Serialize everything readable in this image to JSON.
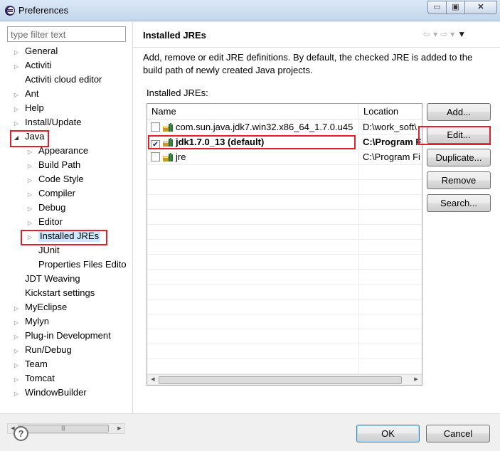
{
  "window": {
    "title": "Preferences",
    "minimize_glyph": "▭",
    "maximize_glyph": "▣",
    "close_glyph": "✕"
  },
  "filter": {
    "placeholder": "type filter text"
  },
  "tree": {
    "items": [
      {
        "label": "General",
        "depth": 0,
        "toggle": "collapsed"
      },
      {
        "label": "Activiti",
        "depth": 0,
        "toggle": "collapsed"
      },
      {
        "label": "Activiti cloud editor",
        "depth": 0,
        "toggle": "none"
      },
      {
        "label": "Ant",
        "depth": 0,
        "toggle": "collapsed"
      },
      {
        "label": "Help",
        "depth": 0,
        "toggle": "collapsed"
      },
      {
        "label": "Install/Update",
        "depth": 0,
        "toggle": "collapsed"
      },
      {
        "label": "Java",
        "depth": 0,
        "toggle": "expanded"
      },
      {
        "label": "Appearance",
        "depth": 1,
        "toggle": "collapsed"
      },
      {
        "label": "Build Path",
        "depth": 1,
        "toggle": "collapsed"
      },
      {
        "label": "Code Style",
        "depth": 1,
        "toggle": "collapsed"
      },
      {
        "label": "Compiler",
        "depth": 1,
        "toggle": "collapsed"
      },
      {
        "label": "Debug",
        "depth": 1,
        "toggle": "collapsed"
      },
      {
        "label": "Editor",
        "depth": 1,
        "toggle": "collapsed"
      },
      {
        "label": "Installed JREs",
        "depth": 1,
        "toggle": "collapsed",
        "selected": true
      },
      {
        "label": "JUnit",
        "depth": 1,
        "toggle": "none"
      },
      {
        "label": "Properties Files Edito",
        "depth": 1,
        "toggle": "none"
      },
      {
        "label": "JDT Weaving",
        "depth": 0,
        "toggle": "none"
      },
      {
        "label": "Kickstart settings",
        "depth": 0,
        "toggle": "none"
      },
      {
        "label": "MyEclipse",
        "depth": 0,
        "toggle": "collapsed"
      },
      {
        "label": "Mylyn",
        "depth": 0,
        "toggle": "collapsed"
      },
      {
        "label": "Plug-in Development",
        "depth": 0,
        "toggle": "collapsed"
      },
      {
        "label": "Run/Debug",
        "depth": 0,
        "toggle": "collapsed"
      },
      {
        "label": "Team",
        "depth": 0,
        "toggle": "collapsed"
      },
      {
        "label": "Tomcat",
        "depth": 0,
        "toggle": "collapsed"
      },
      {
        "label": "WindowBuilder",
        "depth": 0,
        "toggle": "collapsed"
      }
    ]
  },
  "page": {
    "title": "Installed JREs",
    "nav": {
      "back": "⇦",
      "back_menu": "▾",
      "forward": "⇨",
      "forward_menu": "▾",
      "view_menu": "▼"
    },
    "description": "Add, remove or edit JRE definitions. By default, the checked JRE is added to the build path of newly created Java projects.",
    "jres_label": "Installed JREs:"
  },
  "table": {
    "columns": [
      "Name",
      "Location"
    ],
    "rows": [
      {
        "checked": false,
        "bold": false,
        "name": "com.sun.java.jdk7.win32.x86_64_1.7.0.u45",
        "location": "D:\\work_soft\\"
      },
      {
        "checked": true,
        "bold": true,
        "name": "jdk1.7.0_13 (default)",
        "location": "C:\\Program Files"
      },
      {
        "checked": false,
        "bold": false,
        "name": "jre",
        "location": "C:\\Program Fi"
      }
    ],
    "empty_rows": 14
  },
  "buttons": {
    "add": "Add...",
    "edit": "Edit...",
    "duplicate": "Duplicate...",
    "remove": "Remove",
    "search": "Search..."
  },
  "footer": {
    "help_glyph": "?",
    "ok": "OK",
    "cancel": "Cancel"
  },
  "colors": {
    "highlight_box": "#e0202c",
    "selection_bg": "#cde8ff",
    "checkmark": "#2c4b7a",
    "jre_icon_jar": "#c49a2c",
    "jre_icon_books": "#2f6e37"
  }
}
